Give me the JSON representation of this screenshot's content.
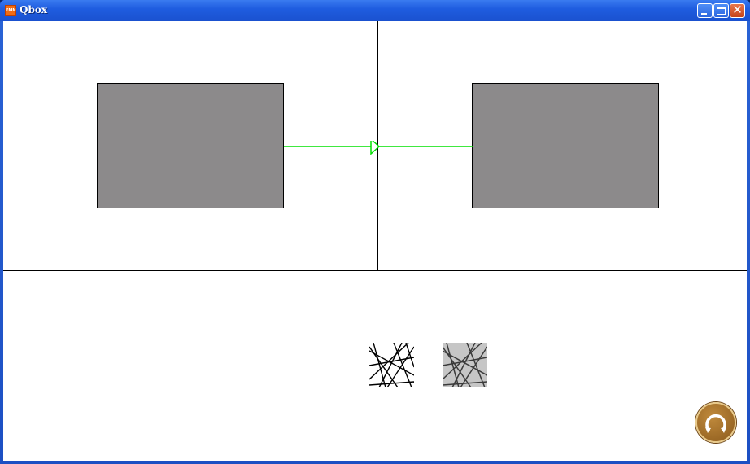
{
  "window": {
    "title": "Qbox",
    "app_icon_text": "FMN",
    "controls": {
      "minimize": "minimize",
      "maximize": "maximize",
      "close": "close"
    }
  },
  "canvas": {
    "left_box": "gray-rectangle",
    "right_box": "gray-rectangle",
    "connector_color": "#00e000",
    "box_color": "#8c8a8b"
  },
  "thumbnails": [
    {
      "name": "line-pattern-black-white"
    },
    {
      "name": "line-pattern-gray"
    }
  ],
  "refresh_button": {
    "icon": "refresh-icon",
    "color": "#a06d2a"
  }
}
